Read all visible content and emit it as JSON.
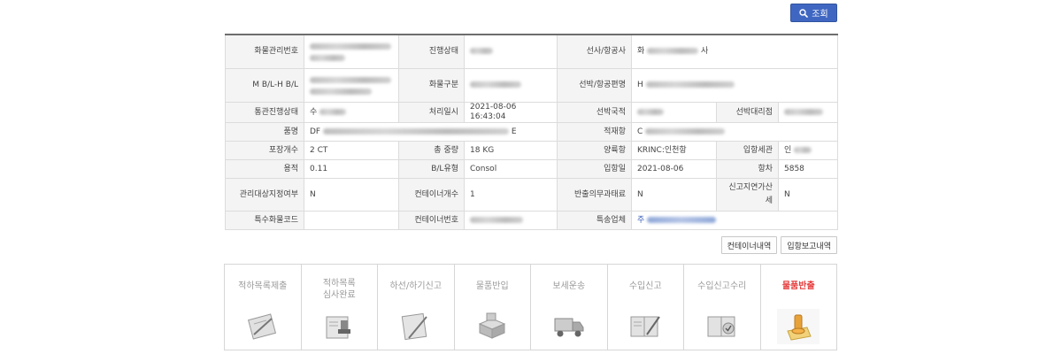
{
  "search_button": {
    "label": "조회"
  },
  "info_table": {
    "rows": [
      {
        "cells": [
          {
            "label": "화물관리번호",
            "value": "",
            "value2": "",
            "redacted": true
          },
          {
            "label": "진행상태",
            "value": "",
            "redacted": true
          },
          {
            "label": "선사/항공사",
            "value": "화",
            "value_suffix": "사",
            "redacted": true
          }
        ]
      },
      {
        "cells": [
          {
            "label": "M B/L-H B/L",
            "value": "",
            "redacted": true
          },
          {
            "label": "화물구분",
            "value": "",
            "redacted": true
          },
          {
            "label": "선박/항공편명",
            "value": "H",
            "redacted": true
          }
        ]
      },
      {
        "cells": [
          {
            "label": "통관진행상태",
            "value": "수",
            "redacted": true
          },
          {
            "label": "처리일시",
            "value": "2021-08-06 16:43:04"
          },
          {
            "label": "선박국적",
            "value": "",
            "redacted": true
          },
          {
            "label": "선박대리점",
            "value": "",
            "redacted": true
          }
        ]
      },
      {
        "cells": [
          {
            "label": "품명",
            "value": "DF",
            "value_suffix": "E",
            "redacted": true
          },
          {
            "label": "적재항",
            "value": "C",
            "redacted": true
          }
        ]
      },
      {
        "cells": [
          {
            "label": "포장개수",
            "value": "2 CT"
          },
          {
            "label": "총 중량",
            "value": "18 KG"
          },
          {
            "label": "양륙항",
            "value": "KRINC:인천항"
          },
          {
            "label": "입항세관",
            "value": "인",
            "redacted": true
          }
        ]
      },
      {
        "cells": [
          {
            "label": "용적",
            "value": "0.11"
          },
          {
            "label": "B/L유형",
            "value": "Consol"
          },
          {
            "label": "입항일",
            "value": "2021-08-06"
          },
          {
            "label": "항차",
            "value": "5858"
          }
        ]
      },
      {
        "cells": [
          {
            "label": "관리대상지정여부",
            "value": "N"
          },
          {
            "label": "컨테이너개수",
            "value": "1"
          },
          {
            "label": "반출의무과태료",
            "value": "N"
          },
          {
            "label": "신고지연가산세",
            "value": "N"
          }
        ]
      },
      {
        "cells": [
          {
            "label": "특수화물코드",
            "value": ""
          },
          {
            "label": "컨테이너번호",
            "value": "",
            "redacted": true
          },
          {
            "label": "특송업체",
            "value": "주",
            "redacted": true,
            "link": true
          }
        ]
      }
    ]
  },
  "actions": {
    "container_history": "컨테이너내역",
    "arrival_report_history": "입항보고내역"
  },
  "steps": [
    {
      "label": "적하목록제출",
      "icon": "document-pencil-icon",
      "active": false
    },
    {
      "label": "적하목록\n심사완료",
      "icon": "stamp-document-icon",
      "active": false
    },
    {
      "label": "하선/하기신고",
      "icon": "clipboard-pen-icon",
      "active": false
    },
    {
      "label": "물품반입",
      "icon": "boxes-icon",
      "active": false
    },
    {
      "label": "보세운송",
      "icon": "truck-icon",
      "active": false
    },
    {
      "label": "수입신고",
      "icon": "book-pen-icon",
      "active": false
    },
    {
      "label": "수입신고수리",
      "icon": "document-check-icon",
      "active": false
    },
    {
      "label": "물품반출",
      "icon": "stamp-package-icon",
      "active": true
    }
  ]
}
